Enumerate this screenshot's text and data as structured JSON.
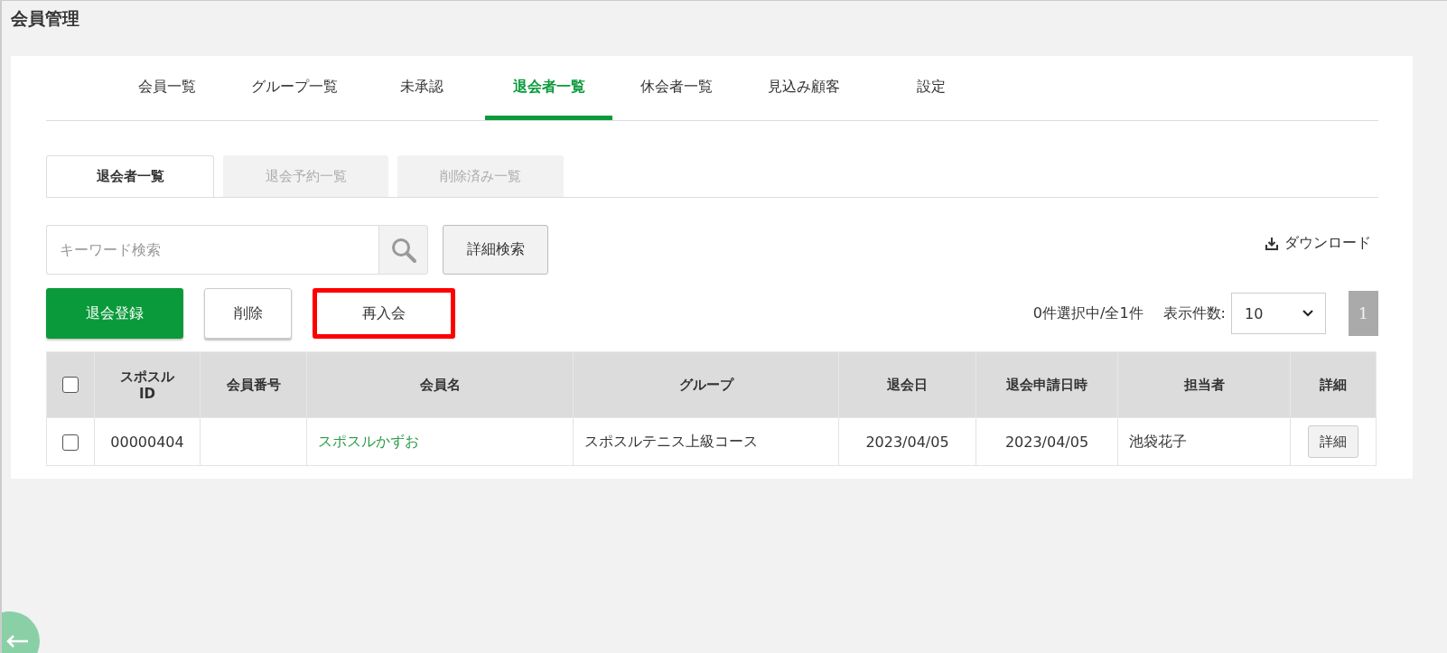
{
  "page_title": "会員管理",
  "tabs": [
    {
      "label": "会員一覧",
      "selected": false
    },
    {
      "label": "グループ一覧",
      "selected": false
    },
    {
      "label": "未承認",
      "selected": false
    },
    {
      "label": "退会者一覧",
      "selected": true
    },
    {
      "label": "休会者一覧",
      "selected": false
    },
    {
      "label": "見込み顧客",
      "selected": false
    },
    {
      "label": "設定",
      "selected": false
    }
  ],
  "sub_tabs": [
    {
      "label": "退会者一覧",
      "selected": true
    },
    {
      "label": "退会予約一覧",
      "selected": false
    },
    {
      "label": "削除済み一覧",
      "selected": false
    }
  ],
  "search": {
    "placeholder": "キーワード検索",
    "advanced_button": "詳細検索"
  },
  "download": "ダウンロード",
  "actions": [
    {
      "label": "退会登録",
      "kind": "primary",
      "highlighted": false
    },
    {
      "label": "削除",
      "kind": "default",
      "highlighted": false
    },
    {
      "label": "再入会",
      "kind": "plain",
      "highlighted": true
    }
  ],
  "selection_count": "0件選択中/全1件",
  "per_page": {
    "label": "表示件数:",
    "value": "10"
  },
  "pages": [
    {
      "label": "1",
      "selected": true
    }
  ],
  "table": {
    "select_all_checked": false,
    "columns": [
      "スポスル\nID",
      "会員番号",
      "会員名",
      "グループ",
      "退会日",
      "退会申請日時",
      "担当者",
      "詳細"
    ],
    "rows": [
      {
        "checked": false,
        "id": "00000404",
        "member_no": "",
        "name": "スポスルかずお",
        "group": "スポスルテニス上級コース",
        "withdrawal_date": "2023/04/05",
        "request_datetime": "2023/04/05",
        "staff": "池袋花子",
        "detail_button": "詳細"
      }
    ]
  }
}
